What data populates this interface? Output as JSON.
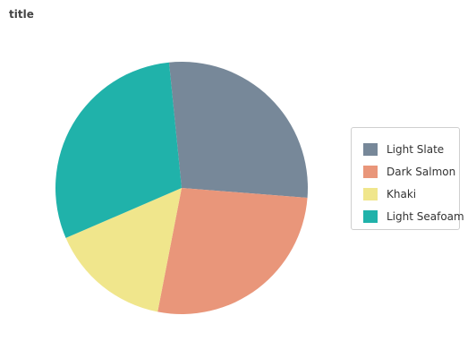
{
  "chart_data": {
    "type": "pie",
    "title": "title",
    "legend_position": "right",
    "categories": [
      "Light Slate",
      "Dark Salmon",
      "Khaki",
      "Light Seafoam"
    ],
    "values": [
      27,
      26,
      15,
      29
    ],
    "colors": [
      "#778899",
      "#E9967A",
      "#F0E68C",
      "#20B2AA"
    ]
  }
}
